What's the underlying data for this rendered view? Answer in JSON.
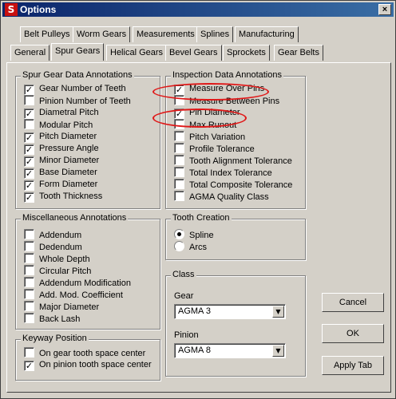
{
  "window": {
    "title": "Options",
    "close_label": "×"
  },
  "tabs_row1": [
    "Belt Pulleys",
    "Worm Gears",
    "Measurements",
    "Splines",
    "Manufacturing"
  ],
  "tabs_row2": [
    "General",
    "Spur Gears",
    "Helical Gears",
    "Bevel Gears",
    "Sprockets",
    "Gear Belts"
  ],
  "active_tab": "Spur Gears",
  "spur_gear_data": {
    "title": "Spur Gear Data Annotations",
    "items": [
      {
        "label": "Gear Number of Teeth",
        "checked": true
      },
      {
        "label": "Pinion Number of Teeth",
        "checked": false
      },
      {
        "label": "Diametral Pitch",
        "checked": true
      },
      {
        "label": "Modular Pitch",
        "checked": false
      },
      {
        "label": "Pitch Diameter",
        "checked": true
      },
      {
        "label": "Pressure Angle",
        "checked": true
      },
      {
        "label": "Minor Diameter",
        "checked": true
      },
      {
        "label": "Base Diameter",
        "checked": true
      },
      {
        "label": "Form Diameter",
        "checked": true
      },
      {
        "label": "Tooth Thickness",
        "checked": true
      }
    ]
  },
  "misc": {
    "title": "Miscellaneous Annotations",
    "items": [
      {
        "label": "Addendum",
        "checked": false
      },
      {
        "label": "Dedendum",
        "checked": false
      },
      {
        "label": "Whole Depth",
        "checked": false
      },
      {
        "label": "Circular Pitch",
        "checked": false
      },
      {
        "label": "Addendum Modification",
        "checked": false
      },
      {
        "label": "Add. Mod. Coefficient",
        "checked": false
      },
      {
        "label": "Major Diameter",
        "checked": false
      },
      {
        "label": "Back Lash",
        "checked": false
      }
    ]
  },
  "keyway": {
    "title": "Keyway Position",
    "items": [
      {
        "label": "On gear tooth space center",
        "checked": false
      },
      {
        "label": "On pinion tooth space center",
        "checked": true
      }
    ]
  },
  "inspection": {
    "title": "Inspection Data Annotations",
    "items": [
      {
        "label": "Measure Over Pins",
        "checked": true
      },
      {
        "label": "Measure Between Pins",
        "checked": false
      },
      {
        "label": "Pin Diameter",
        "checked": true
      },
      {
        "label": "Max Runout",
        "checked": false
      },
      {
        "label": "Pitch Variation",
        "checked": false
      },
      {
        "label": "Profile Tolerance",
        "checked": false
      },
      {
        "label": "Tooth Alignment Tolerance",
        "checked": false
      },
      {
        "label": "Total Index Tolerance",
        "checked": false
      },
      {
        "label": "Total Composite Tolerance",
        "checked": false
      },
      {
        "label": "AGMA Quality Class",
        "checked": false
      }
    ]
  },
  "tooth_creation": {
    "title": "Tooth Creation",
    "options": [
      {
        "label": "Spline",
        "selected": true
      },
      {
        "label": "Arcs",
        "selected": false
      }
    ]
  },
  "class": {
    "title": "Class",
    "gear_label": "Gear",
    "gear_value": "AGMA 3",
    "pinion_label": "Pinion",
    "pinion_value": "AGMA 8"
  },
  "buttons": {
    "cancel": "Cancel",
    "ok": "OK",
    "apply": "Apply Tab"
  },
  "colors": {
    "titlebar": "#0a246a",
    "highlight_ellipse": "#e01818",
    "dialog_face": "#d4d0c8"
  }
}
